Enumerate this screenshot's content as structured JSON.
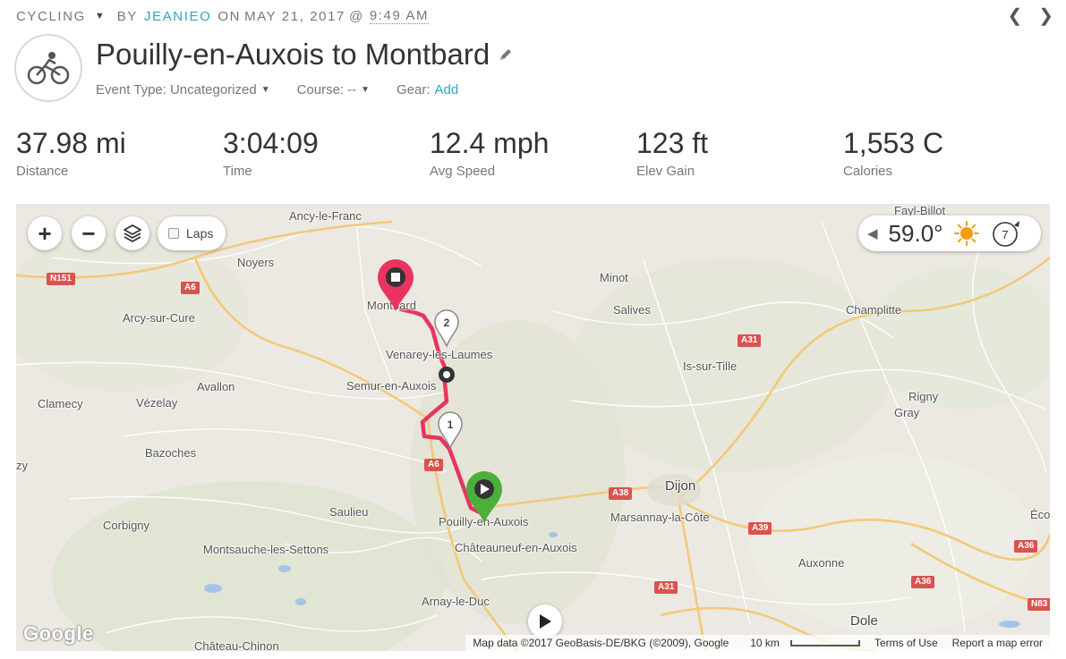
{
  "header": {
    "activity_type": "CYCLING",
    "by_label": "BY",
    "author": "JEANIEO",
    "on_label": "ON",
    "date": "MAY 21, 2017",
    "at_label": "@",
    "time": "9:49 AM",
    "prev_icon": "chevron-left-icon",
    "next_icon": "chevron-right-icon"
  },
  "activity": {
    "icon": "bicycle-icon",
    "title": "Pouilly-en-Auxois to Montbard",
    "event_type_label": "Event Type:",
    "event_type_value": "Uncategorized",
    "course_label": "Course:",
    "course_value": "--",
    "gear_label": "Gear:",
    "gear_link": "Add"
  },
  "stats": [
    {
      "value": "37.98 mi",
      "label": "Distance"
    },
    {
      "value": "3:04:09",
      "label": "Time"
    },
    {
      "value": "12.4 mph",
      "label": "Avg Speed"
    },
    {
      "value": "123 ft",
      "label": "Elev Gain"
    },
    {
      "value": "1,553 C",
      "label": "Calories"
    }
  ],
  "map": {
    "zoom_in": "+",
    "zoom_out": "−",
    "layers_icon": "layers-icon",
    "laps_label": "Laps",
    "laps_checked": false,
    "weather": {
      "temperature": "59.0°",
      "condition_icon": "sun-icon",
      "wind_speed": "7",
      "wind_icon": "wind-direction-icon"
    },
    "markers": {
      "start": "play-icon",
      "end": "stop-icon",
      "lap1": "1",
      "lap2": "2"
    },
    "places": [
      {
        "name": "Ancy-le-Franc"
      },
      {
        "name": "Noyers"
      },
      {
        "name": "Montbard"
      },
      {
        "name": "Minot"
      },
      {
        "name": "Salives"
      },
      {
        "name": "Champlitte"
      },
      {
        "name": "Fayl-Billot"
      },
      {
        "name": "Arcy-sur-Cure"
      },
      {
        "name": "Venarey-les-Laumes"
      },
      {
        "name": "Is-sur-Tille"
      },
      {
        "name": "Semur-en-Auxois"
      },
      {
        "name": "Avallon"
      },
      {
        "name": "Clamecy"
      },
      {
        "name": "Vézelay"
      },
      {
        "name": "Rigny"
      },
      {
        "name": "Gray"
      },
      {
        "name": "Bazoches"
      },
      {
        "name": "Dijon"
      },
      {
        "name": "Saulieu"
      },
      {
        "name": "Marsannay-la-Côte"
      },
      {
        "name": "Pouilly-en-Auxois"
      },
      {
        "name": "Corbigny"
      },
      {
        "name": "Châteauneuf-en-Auxois"
      },
      {
        "name": "Montsauche-les-Settons"
      },
      {
        "name": "Auxonne"
      },
      {
        "name": "Arnay-le-Duc"
      },
      {
        "name": "Dole"
      },
      {
        "name": "Château-Chinon"
      },
      {
        "name": "zy"
      },
      {
        "name": "Éco"
      }
    ],
    "roads": [
      "N151",
      "A6",
      "A6",
      "A31",
      "A38",
      "A39",
      "A36",
      "A36",
      "A31",
      "N83"
    ],
    "replay_icon": "play-icon",
    "google_logo": "Google",
    "attribution": "Map data ©2017 GeoBasis-DE/BKG (©2009), Google",
    "scale": "10 km",
    "terms": "Terms of Use",
    "report": "Report a map error"
  }
}
